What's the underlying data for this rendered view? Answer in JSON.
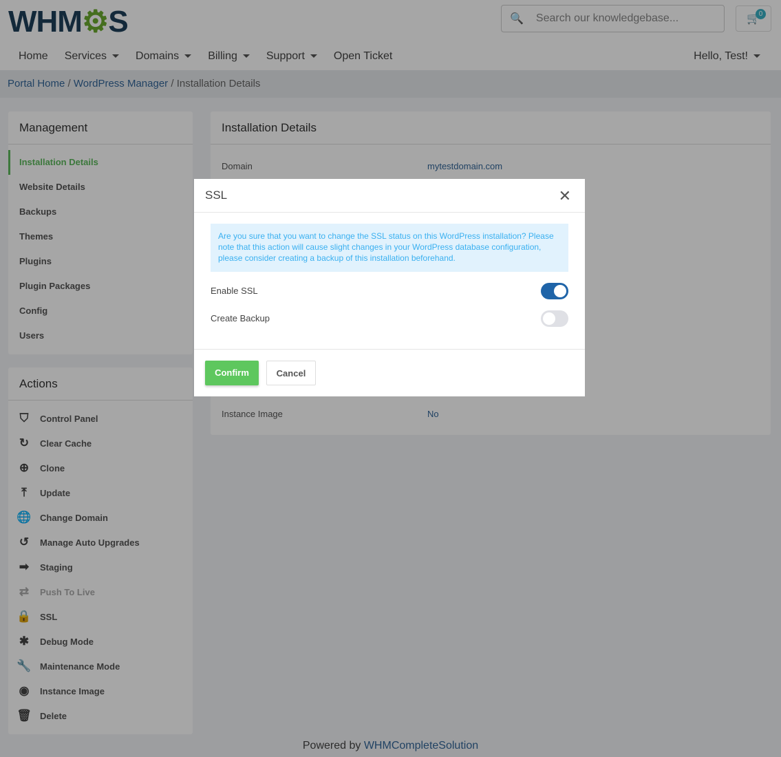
{
  "header": {
    "logo": "WHMCS",
    "search_placeholder": "Search our knowledgebase...",
    "cart_count": "0",
    "greeting": "Hello, Test!"
  },
  "nav": [
    {
      "label": "Home",
      "dropdown": false
    },
    {
      "label": "Services",
      "dropdown": true
    },
    {
      "label": "Domains",
      "dropdown": true
    },
    {
      "label": "Billing",
      "dropdown": true
    },
    {
      "label": "Support",
      "dropdown": true
    },
    {
      "label": "Open Ticket",
      "dropdown": false
    }
  ],
  "breadcrumb": [
    "Portal Home",
    "WordPress Manager",
    "Installation Details"
  ],
  "management": {
    "title": "Management",
    "items": [
      "Installation Details",
      "Website Details",
      "Backups",
      "Themes",
      "Plugins",
      "Plugin Packages",
      "Config",
      "Users"
    ],
    "active": "Installation Details"
  },
  "actions": {
    "title": "Actions",
    "items": [
      {
        "label": "Control Panel",
        "icon": "shield-icon"
      },
      {
        "label": "Clear Cache",
        "icon": "refresh-icon"
      },
      {
        "label": "Clone",
        "icon": "clone-plus-icon"
      },
      {
        "label": "Update",
        "icon": "upload-icon"
      },
      {
        "label": "Change Domain",
        "icon": "globe-icon"
      },
      {
        "label": "Manage Auto Upgrades",
        "icon": "history-icon"
      },
      {
        "label": "Staging",
        "icon": "arrow-right-icon"
      },
      {
        "label": "Push To Live",
        "icon": "repeat-icon",
        "disabled": true
      },
      {
        "label": "SSL",
        "icon": "lock-icon"
      },
      {
        "label": "Debug Mode",
        "icon": "bug-icon"
      },
      {
        "label": "Maintenance Mode",
        "icon": "wrench-icon"
      },
      {
        "label": "Instance Image",
        "icon": "instance-icon"
      },
      {
        "label": "Delete",
        "icon": "trash-icon"
      }
    ]
  },
  "details": {
    "title": "Installation Details",
    "rows": [
      {
        "label": "Domain",
        "value": "mytestdomain.com"
      },
      {
        "label": "Instance Image",
        "value": "No"
      }
    ]
  },
  "modal": {
    "title": "SSL",
    "message": "Are you sure that you want to change the SSL status on this WordPress installation? Please note that this action will cause slight changes in your WordPress database configuration, please consider creating a backup of this installation beforehand.",
    "options": [
      {
        "label": "Enable SSL",
        "enabled": true
      },
      {
        "label": "Create Backup",
        "enabled": false
      }
    ],
    "confirm": "Confirm",
    "cancel": "Cancel"
  },
  "footer": {
    "prefix": "Powered by",
    "link": "WHMCompleteSolution"
  }
}
